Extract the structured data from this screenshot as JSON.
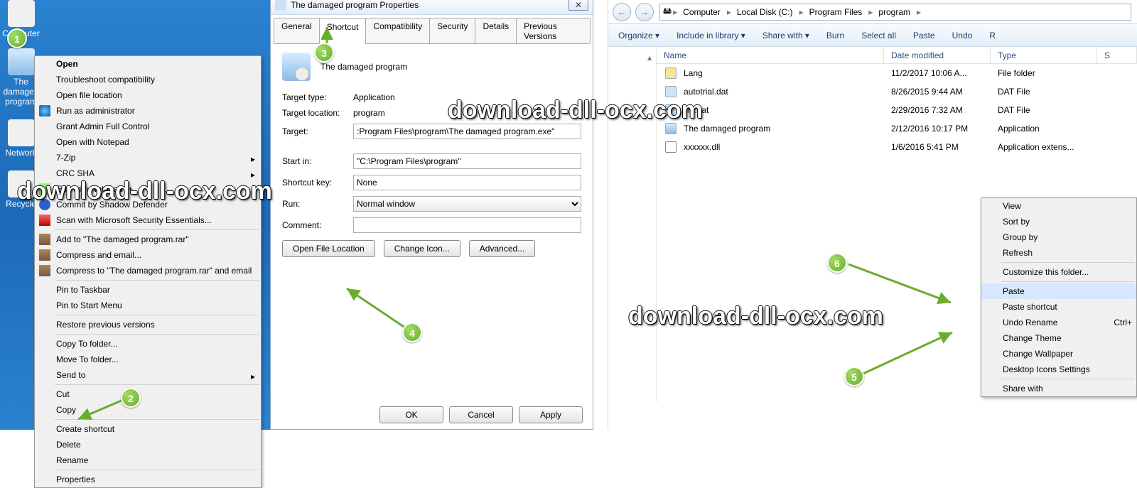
{
  "watermark": "download-dll-ocx.com",
  "desktop": {
    "icons": [
      {
        "label": "Computer"
      },
      {
        "label": "The damaged program"
      },
      {
        "label": "Network"
      },
      {
        "label": "Recycle"
      }
    ],
    "context_menu": {
      "open": "Open",
      "troubleshoot": "Troubleshoot compatibility",
      "open_loc": "Open file location",
      "run_admin": "Run as administrator",
      "grant_admin": "Grant Admin Full Control",
      "open_notepad": "Open with Notepad",
      "seven_zip": "7-Zip",
      "crc": "CRC SHA",
      "edit_npp": "Edit with Notepad++",
      "commit_sd": "Commit by Shadow Defender",
      "scan": "Scan with Microsoft Security Essentials...",
      "add_rar": "Add to \"The damaged program.rar\"",
      "compress_email": "Compress and email...",
      "compress_rar_email": "Compress to \"The damaged program.rar\" and email",
      "pin_taskbar": "Pin to Taskbar",
      "pin_start": "Pin to Start Menu",
      "restore_prev": "Restore previous versions",
      "copy_to": "Copy To folder...",
      "move_to": "Move To folder...",
      "send_to": "Send to",
      "cut": "Cut",
      "copy": "Copy",
      "create_shortcut": "Create shortcut",
      "delete": "Delete",
      "rename": "Rename",
      "properties": "Properties"
    }
  },
  "props": {
    "title": "The damaged program Properties",
    "tabs": [
      "General",
      "Shortcut",
      "Compatibility",
      "Security",
      "Details",
      "Previous Versions"
    ],
    "name": "The damaged program",
    "lbl_target_type": "Target type:",
    "target_type": "Application",
    "lbl_target_loc": "Target location:",
    "target_loc": "program",
    "lbl_target": "Target:",
    "target": ":Program Files\\program\\The damaged program.exe\"",
    "lbl_start": "Start in:",
    "start": "\"C:\\Program Files\\program\"",
    "lbl_shortcut": "Shortcut key:",
    "shortcut": "None",
    "lbl_run": "Run:",
    "run": "Normal window",
    "lbl_comment": "Comment:",
    "comment": "",
    "btn_open_loc": "Open File Location",
    "btn_change_icon": "Change Icon...",
    "btn_advanced": "Advanced...",
    "btn_ok": "OK",
    "btn_cancel": "Cancel",
    "btn_apply": "Apply"
  },
  "explorer": {
    "breadcrumbs": [
      "Computer",
      "Local Disk (C:)",
      "Program Files",
      "program"
    ],
    "toolbar": {
      "organize": "Organize ▾",
      "include": "Include in library ▾",
      "share": "Share with ▾",
      "burn": "Burn",
      "select_all": "Select all",
      "paste": "Paste",
      "undo": "Undo",
      "r": "R"
    },
    "cols": [
      "Name",
      "Date modified",
      "Type",
      "S"
    ],
    "files": [
      {
        "n": "Lang",
        "d": "11/2/2017 10:06 A...",
        "t": "File folder",
        "ic": "folder"
      },
      {
        "n": "autotrial.dat",
        "d": "8/26/2015 9:44 AM",
        "t": "DAT File",
        "ic": "file"
      },
      {
        "n": "file.dat",
        "d": "2/29/2016 7:32 AM",
        "t": "DAT File",
        "ic": "file"
      },
      {
        "n": "The damaged program",
        "d": "2/12/2016 10:17 PM",
        "t": "Application",
        "ic": "app"
      },
      {
        "n": "xxxxxx.dll",
        "d": "1/6/2016 5:41 PM",
        "t": "Application extens...",
        "ic": "dll"
      }
    ],
    "ctx": {
      "view": "View",
      "sort": "Sort by",
      "group": "Group by",
      "refresh": "Refresh",
      "customize": "Customize this folder...",
      "paste": "Paste",
      "paste_shortcut": "Paste shortcut",
      "undo_rename": "Undo Rename",
      "undo_shortcut": "Ctrl+",
      "change_theme": "Change Theme",
      "change_wallpaper": "Change Wallpaper",
      "desktop_icons": "Desktop Icons Settings",
      "share_with": "Share with"
    }
  }
}
